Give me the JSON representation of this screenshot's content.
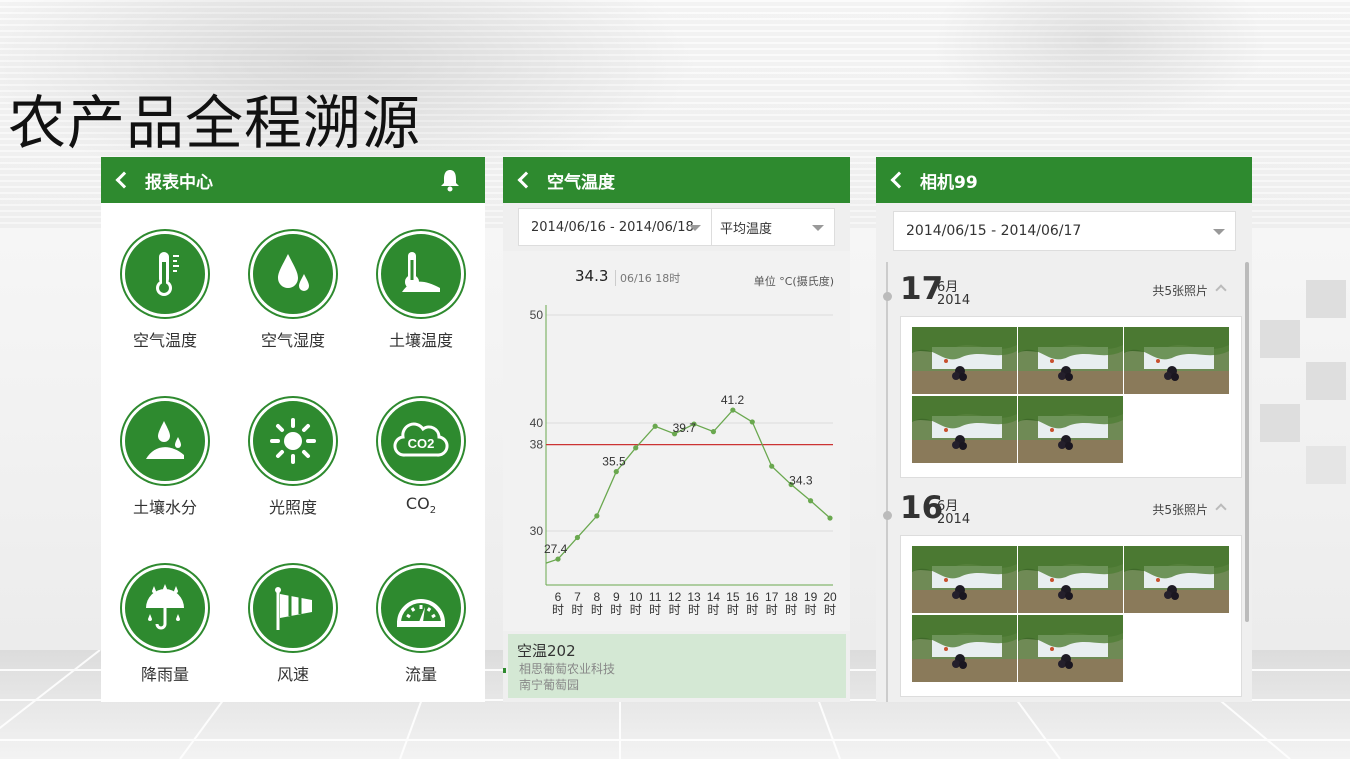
{
  "page_title": "农产品全程溯源",
  "report_center": {
    "title": "报表中心",
    "items": [
      {
        "label": "空气温度",
        "icon": "thermometer-icon"
      },
      {
        "label": "空气湿度",
        "icon": "water-drops-icon"
      },
      {
        "label": "土壤温度",
        "icon": "soil-thermometer-icon"
      },
      {
        "label": "土壤水分",
        "icon": "soil-moisture-icon"
      },
      {
        "label": "光照度",
        "icon": "sun-icon"
      },
      {
        "label": "CO",
        "sub": "2",
        "icon": "co2-cloud-icon"
      },
      {
        "label": "降雨量",
        "icon": "umbrella-rain-icon"
      },
      {
        "label": "风速",
        "icon": "windsock-icon"
      },
      {
        "label": "流量",
        "icon": "gauge-icon"
      }
    ],
    "co2_icon_text": "CO2"
  },
  "air_temp": {
    "title": "空气温度",
    "date_range": "2014/06/16 - 2014/06/18",
    "metric": "平均温度",
    "readout_value": "34.3",
    "readout_time": "06/16 18时",
    "unit": "单位 °C(摄氏度)",
    "station_name": "空温202",
    "station_org": "相思葡萄农业科技",
    "station_place": "南宁葡萄园"
  },
  "chart_data": {
    "type": "line",
    "x": [
      "6时",
      "7时",
      "8时",
      "9时",
      "10时",
      "11时",
      "12时",
      "13时",
      "14时",
      "15时",
      "16时",
      "17时",
      "18时",
      "19时",
      "20时"
    ],
    "values": [
      27.4,
      29.4,
      31.4,
      35.5,
      37.7,
      39.7,
      39.0,
      39.9,
      39.2,
      41.2,
      40.1,
      36.0,
      34.3,
      32.8,
      31.2
    ],
    "labeled_points": [
      {
        "x": "6时",
        "label": "27.4"
      },
      {
        "x": "9时",
        "label": "35.5"
      },
      {
        "x": "12时",
        "label": "39.7"
      },
      {
        "x": "15时",
        "label": "41.2"
      },
      {
        "x": "18时",
        "label": "34.3"
      }
    ],
    "ylim": [
      25,
      50
    ],
    "yticks": [
      "50",
      "40",
      "38",
      "30"
    ],
    "reference_line": 38,
    "line_color": "#6aa84f",
    "reference_color": "#cc3333"
  },
  "camera": {
    "title": "相机99",
    "date_range": "2014/06/15 - 2014/06/17",
    "days": [
      {
        "day": "17",
        "month": "6月",
        "year": "2014",
        "count": "共5张照片"
      },
      {
        "day": "16",
        "month": "6月",
        "year": "2014",
        "count": "共5张照片"
      }
    ]
  },
  "colors": {
    "brand_green": "#2e8a2f"
  }
}
